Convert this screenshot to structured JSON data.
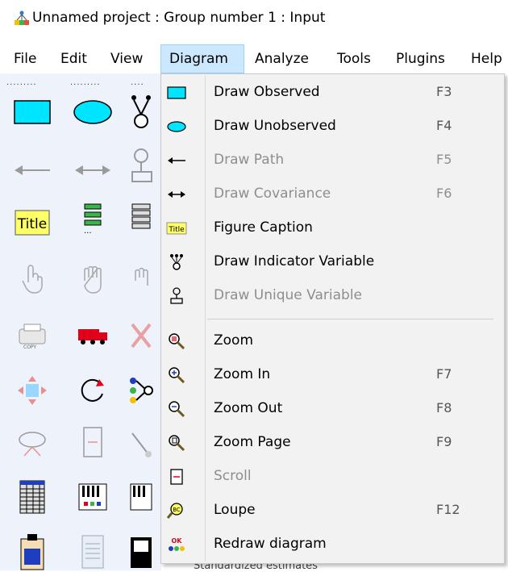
{
  "window": {
    "title": "Unnamed project : Group number 1 : Input",
    "icon": "network-icon"
  },
  "menubar": {
    "items": [
      {
        "label": "File"
      },
      {
        "label": "Edit"
      },
      {
        "label": "View"
      },
      {
        "label": "Diagram",
        "active": true
      },
      {
        "label": "Analyze"
      },
      {
        "label": "Tools"
      },
      {
        "label": "Plugins"
      },
      {
        "label": "Help"
      }
    ]
  },
  "toolbox": {
    "tools": [
      "draw-observed-icon",
      "draw-unobserved-icon",
      "draw-indicator-icon",
      "draw-path-icon",
      "draw-covariance-icon",
      "draw-unique-icon",
      "title-icon",
      "list-variables-model-icon",
      "list-variables-dataset-icon",
      "select-one-icon",
      "select-all-icon",
      "deselect-icon",
      "duplicate-icon",
      "move-icon",
      "erase-icon",
      "move-parameter-icon",
      "rotate-icon",
      "reflect-icon",
      "shape-change-icon",
      "scroll-icon",
      "touch-up-icon",
      "data-files-icon",
      "analysis-properties-icon",
      "calculate-estimates-icon",
      "copy-to-clipboard-icon",
      "view-text-icon",
      "save-icon"
    ]
  },
  "diagram_menu": {
    "items": [
      {
        "label": "Draw Observed",
        "shortcut": "F3",
        "icon": "rectangle-icon",
        "disabled": false
      },
      {
        "label": "Draw Unobserved",
        "shortcut": "F4",
        "icon": "ellipse-icon",
        "disabled": false
      },
      {
        "label": "Draw Path",
        "shortcut": "F5",
        "icon": "left-arrow-icon",
        "disabled": true
      },
      {
        "label": "Draw Covariance",
        "shortcut": "F6",
        "icon": "double-arrow-icon",
        "disabled": true
      },
      {
        "label": "Figure Caption",
        "shortcut": "",
        "icon": "title-icon",
        "disabled": false
      },
      {
        "label": "Draw Indicator Variable",
        "shortcut": "",
        "icon": "indicator-icon",
        "disabled": false
      },
      {
        "label": "Draw Unique Variable",
        "shortcut": "",
        "icon": "unique-variable-icon",
        "disabled": true
      },
      {
        "label": "Zoom",
        "shortcut": "",
        "icon": "zoom-icon",
        "disabled": false
      },
      {
        "label": "Zoom In",
        "shortcut": "F7",
        "icon": "zoom-in-icon",
        "disabled": false
      },
      {
        "label": "Zoom Out",
        "shortcut": "F8",
        "icon": "zoom-out-icon",
        "disabled": false
      },
      {
        "label": "Zoom Page",
        "shortcut": "F9",
        "icon": "zoom-page-icon",
        "disabled": false
      },
      {
        "label": "Scroll",
        "shortcut": "",
        "icon": "scroll-icon",
        "disabled": true
      },
      {
        "label": "Loupe",
        "shortcut": "F12",
        "icon": "loupe-icon",
        "disabled": false
      },
      {
        "label": "Redraw diagram",
        "shortcut": "",
        "icon": "redraw-icon",
        "disabled": false
      }
    ]
  },
  "background_partial_text": "Standardized estimates",
  "colors": {
    "accent": "#cce8ff",
    "observed_fill": "#00e5ff",
    "toolbox_bg": "#eef3fb",
    "menu_bg": "#f2f2f2"
  }
}
